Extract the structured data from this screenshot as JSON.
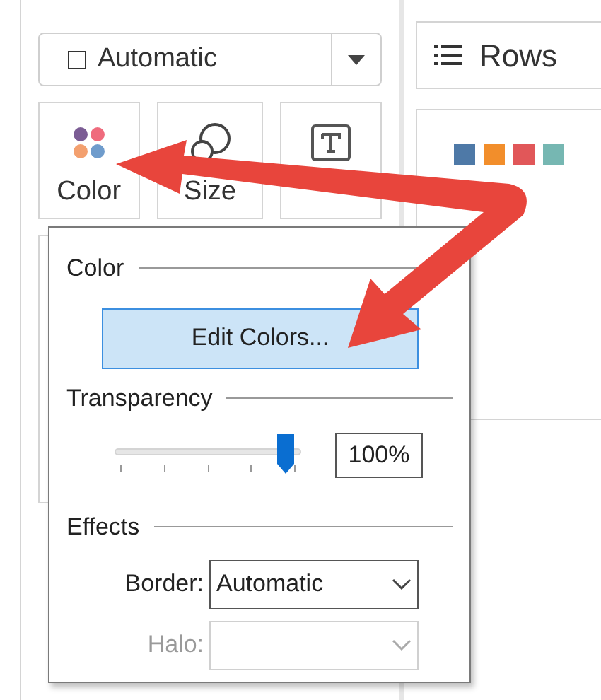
{
  "mark_type_dropdown": {
    "value": "Automatic"
  },
  "mark_buttons": [
    {
      "kind": "color",
      "label": "Color"
    },
    {
      "kind": "size",
      "label": "Size"
    },
    {
      "kind": "text"
    }
  ],
  "rows_shelf": {
    "label": "Rows"
  },
  "legend": [
    {
      "color": "#4e79a7"
    },
    {
      "color": "#f28e2b"
    },
    {
      "color": "#e15759"
    },
    {
      "color": "#76b7b2"
    }
  ],
  "color_popup": {
    "color_section": "Color",
    "edit_button": "Edit Colors...",
    "transparency_section": "Transparency",
    "transparency": {
      "level": 0.96,
      "value": "100%"
    },
    "effects_section": "Effects",
    "fields": [
      {
        "label": "Border:",
        "value": "Automatic",
        "disabled": false
      },
      {
        "label": "Halo:",
        "disabled": true
      }
    ]
  }
}
